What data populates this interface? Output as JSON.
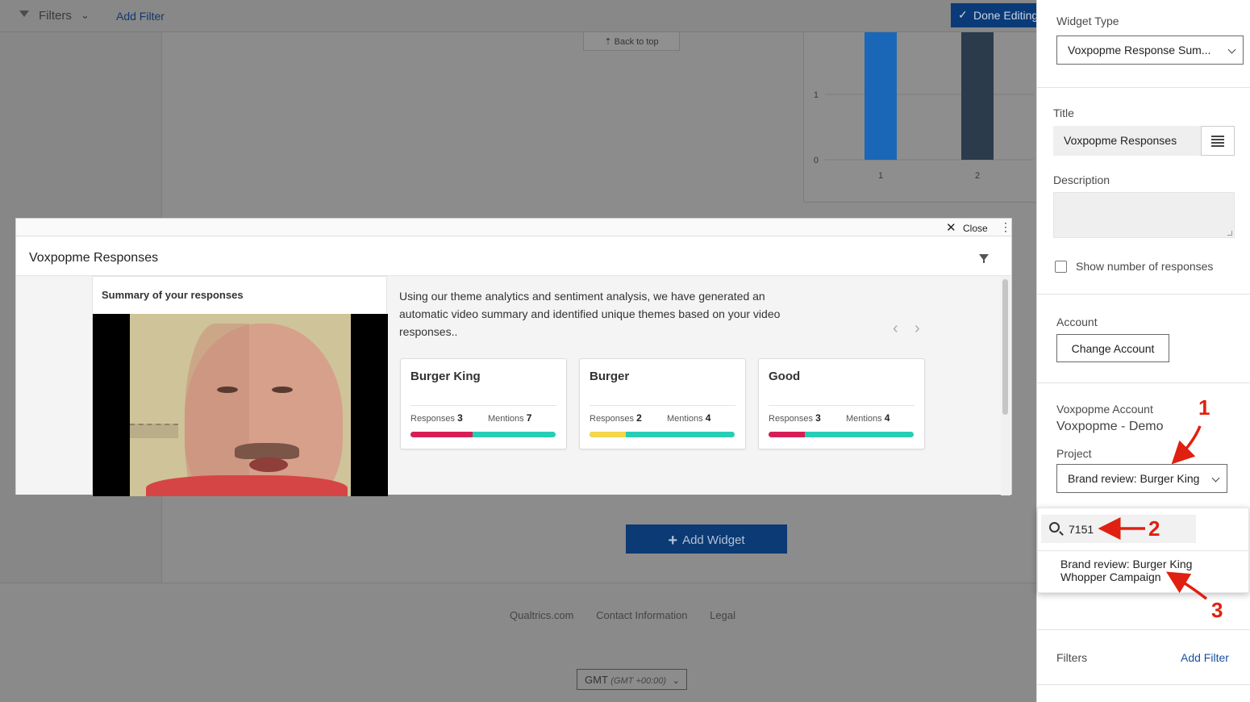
{
  "topbar": {
    "filters_label": "Filters",
    "add_filter": "Add Filter",
    "done_editing": "Done Editing"
  },
  "dashboard": {
    "back_to_top": "⇡ Back to top",
    "add_widget": "Add Widget"
  },
  "background_chart": {
    "y_ticks": [
      "0",
      "1"
    ],
    "categories": [
      "1",
      "2"
    ]
  },
  "chart_data": {
    "type": "bar",
    "categories": [
      "1",
      "2"
    ],
    "values": [
      2,
      2
    ],
    "ylim": [
      0,
      2
    ],
    "colors": [
      "#1a67b8",
      "#2b3b4c"
    ],
    "grid": true
  },
  "modal": {
    "close_label": "Close",
    "title": "Voxpopme Responses",
    "summary_title": "Summary of your responses",
    "summary_text": "Using our theme analytics and sentiment analysis, we have generated an automatic video summary and identified unique themes based on your video responses..",
    "themes": [
      {
        "name": "Burger King",
        "responses_label": "Responses",
        "responses": "3",
        "mentions_label": "Mentions",
        "mentions": "7",
        "negative_share": 0.43,
        "negative_color": "#d81f55"
      },
      {
        "name": "Burger",
        "responses_label": "Responses",
        "responses": "2",
        "mentions_label": "Mentions",
        "mentions": "4",
        "negative_share": 0.25,
        "negative_color": "#f5d54a"
      },
      {
        "name": "Good",
        "responses_label": "Responses",
        "responses": "3",
        "mentions_label": "Mentions",
        "mentions": "4",
        "negative_share": 0.25,
        "negative_color": "#d81f55"
      }
    ]
  },
  "footer": {
    "links": [
      "Qualtrics.com",
      "Contact Information",
      "Legal"
    ],
    "timezone": "GMT",
    "timezone_offset": "(GMT +00:00)"
  },
  "panel": {
    "widget_type_label": "Widget Type",
    "widget_type_value": "Voxpopme Response Sum...",
    "title_label": "Title",
    "title_value": "Voxpopme Responses",
    "description_label": "Description",
    "show_responses_label": "Show number of responses",
    "account_label": "Account",
    "change_account": "Change Account",
    "voxpopme_account_label": "Voxpopme Account",
    "voxpopme_account_value": "Voxpopme - Demo",
    "project_label": "Project",
    "project_value": "Brand review: Burger King",
    "search_value": "7151",
    "dropdown_option": "Brand review: Burger King Whopper Campaign",
    "filters_label": "Filters",
    "add_filter": "Add Filter"
  },
  "annotations": [
    "1",
    "2",
    "3"
  ]
}
